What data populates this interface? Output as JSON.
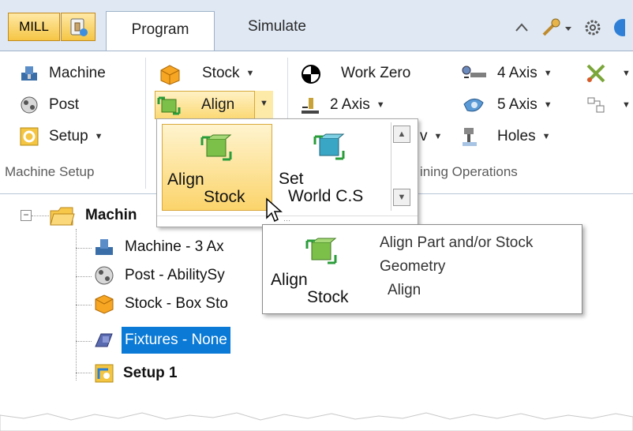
{
  "tabbar": {
    "mill_label": "MILL",
    "tabs": [
      {
        "label": "Program",
        "active": true
      },
      {
        "label": "Simulate",
        "active": false
      }
    ]
  },
  "ribbon": {
    "machine_setup": {
      "items": [
        {
          "label": "Machine"
        },
        {
          "label": "Post"
        },
        {
          "label": "Setup"
        }
      ],
      "group_label": "Machine Setup"
    },
    "stock_group": {
      "stock_label": "Stock",
      "align_label": "Align"
    },
    "operations": {
      "col1": [
        {
          "label": "Work Zero"
        },
        {
          "label": "2 Axis"
        },
        {
          "label": "v"
        }
      ],
      "col2": [
        {
          "label": "4 Axis"
        },
        {
          "label": "5 Axis"
        },
        {
          "label": "Holes"
        }
      ],
      "group_label_visible": "ining Operations"
    }
  },
  "gallery": {
    "items": [
      {
        "line1": "Align",
        "line2": "Stock",
        "selected": true
      },
      {
        "line1": "Set",
        "line2": "World C.S",
        "selected": false
      }
    ]
  },
  "tree": {
    "root": "Machin",
    "children": [
      {
        "label": "Machine - 3 Ax",
        "selected": false
      },
      {
        "label": "Post - AbilitySy",
        "selected": false
      },
      {
        "label": "Stock - Box Sto",
        "selected": false
      },
      {
        "label": "Fixtures - None",
        "selected": true
      }
    ],
    "setup": "Setup 1"
  },
  "tooltip": {
    "icon_line1": "Align",
    "icon_line2": "Stock",
    "description_line1": "Align Part and/or Stock",
    "description_line2": "Geometry",
    "command": "Align"
  },
  "colors": {
    "tab_bar_bg": "#dfe8f3",
    "highlight_yellow": "#fbd46b",
    "tree_selection": "#0a7ad6"
  }
}
